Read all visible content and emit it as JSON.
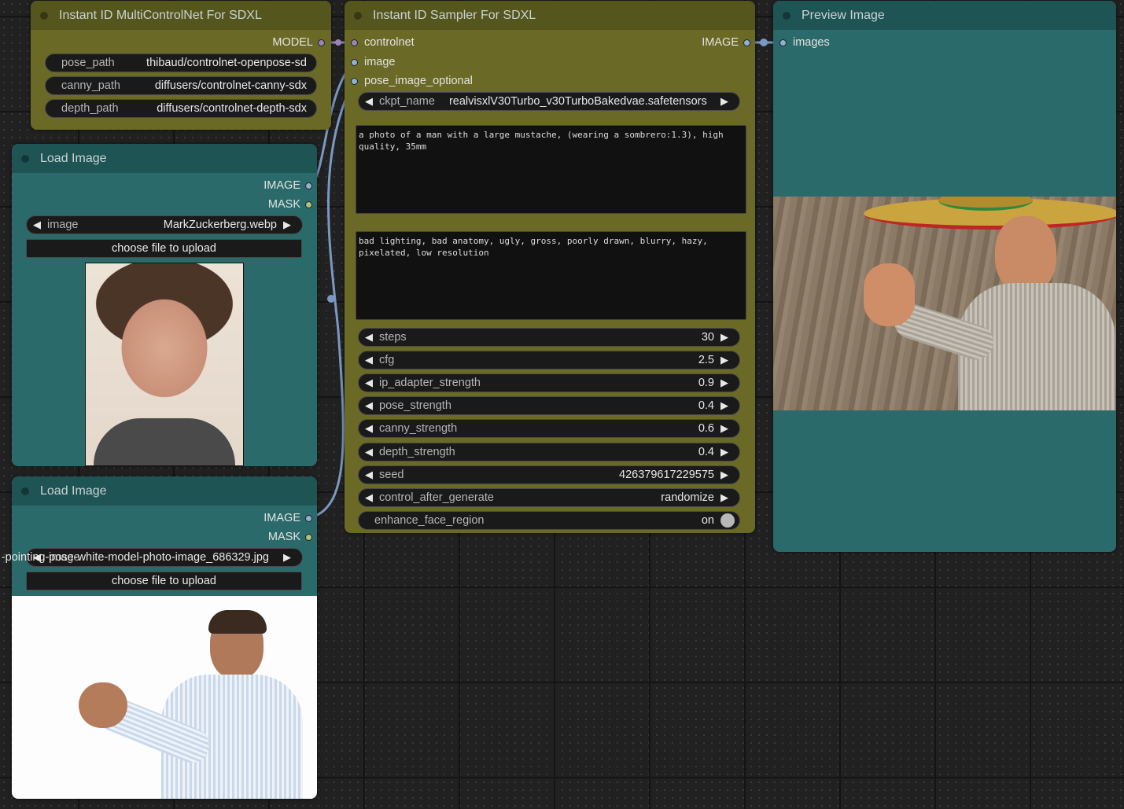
{
  "colors": {
    "model_dot": "#9b84b4",
    "image_dot": "#8fb2d4",
    "mask_dot": "#a8c47e",
    "link_image": "#7a99c2",
    "link_model": "#9b84b4"
  },
  "multicontrolnet": {
    "title": "Instant ID MultiControlNet For SDXL",
    "output_model": "MODEL",
    "widgets": [
      {
        "label": "pose_path",
        "value": "thibaud/controlnet-openpose-sd"
      },
      {
        "label": "canny_path",
        "value": "diffusers/controlnet-canny-sdx"
      },
      {
        "label": "depth_path",
        "value": "diffusers/controlnet-depth-sdx"
      }
    ]
  },
  "load_image_1": {
    "title": "Load Image",
    "output_image": "IMAGE",
    "output_mask": "MASK",
    "image_label": "image",
    "image_value": "MarkZuckerberg.webp",
    "upload_label": "choose file to upload"
  },
  "load_image_2": {
    "title": "Load Image",
    "output_image": "IMAGE",
    "output_mask": "MASK",
    "image_label": "image",
    "image_value": "-pointing-pose-white-model-photo-image_686329.jpg",
    "upload_label": "choose file to upload"
  },
  "sampler": {
    "title": "Instant ID Sampler For SDXL",
    "inputs": [
      "controlnet",
      "image",
      "pose_image_optional"
    ],
    "output_image": "IMAGE",
    "ckpt_label": "ckpt_name",
    "ckpt_value": "realvisxlV30Turbo_v30TurboBakedvae.safetensors",
    "positive_prompt": "a photo of a man with a large mustache, (wearing a sombrero:1.3), high\nquality, 35mm",
    "negative_prompt": "bad lighting, bad anatomy, ugly, gross, poorly drawn, blurry, hazy,\npixelated, low resolution",
    "params": [
      {
        "label": "steps",
        "value": "30"
      },
      {
        "label": "cfg",
        "value": "2.5"
      },
      {
        "label": "ip_adapter_strength",
        "value": "0.9"
      },
      {
        "label": "pose_strength",
        "value": "0.4"
      },
      {
        "label": "canny_strength",
        "value": "0.6"
      },
      {
        "label": "depth_strength",
        "value": "0.4"
      },
      {
        "label": "seed",
        "value": "426379617229575"
      },
      {
        "label": "control_after_generate",
        "value": "randomize"
      }
    ],
    "toggle_label": "enhance_face_region",
    "toggle_value": "on"
  },
  "preview": {
    "title": "Preview Image",
    "input_images": "images"
  }
}
